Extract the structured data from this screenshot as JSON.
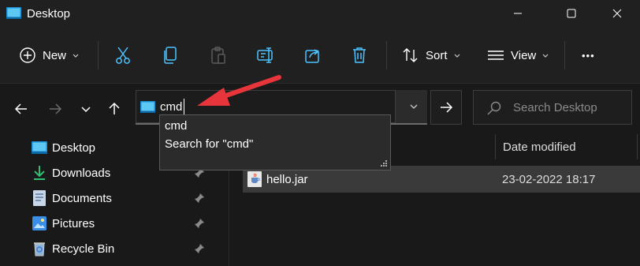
{
  "window": {
    "title": "Desktop"
  },
  "toolbar": {
    "new_label": "New",
    "sort_label": "Sort",
    "view_label": "View",
    "more_label": "•••"
  },
  "address_bar": {
    "value": "cmd"
  },
  "address_suggestions": [
    {
      "label": "cmd"
    },
    {
      "label": "Search for \"cmd\""
    }
  ],
  "search": {
    "placeholder": "Search Desktop"
  },
  "sidebar": {
    "items": [
      {
        "label": "Desktop",
        "icon": "desktop-icon"
      },
      {
        "label": "Downloads",
        "icon": "download-icon"
      },
      {
        "label": "Documents",
        "icon": "documents-icon"
      },
      {
        "label": "Pictures",
        "icon": "pictures-icon"
      },
      {
        "label": "Recycle Bin",
        "icon": "recycle-bin-icon"
      }
    ]
  },
  "file_list": {
    "columns": {
      "date_modified": "Date modified"
    },
    "rows": [
      {
        "name": "hello.jar",
        "date_modified": "23-02-2022 18:17",
        "icon": "jar-file-icon"
      }
    ]
  },
  "colors": {
    "accent": "#4cc2ff",
    "annotation_arrow": "#e8353b"
  }
}
